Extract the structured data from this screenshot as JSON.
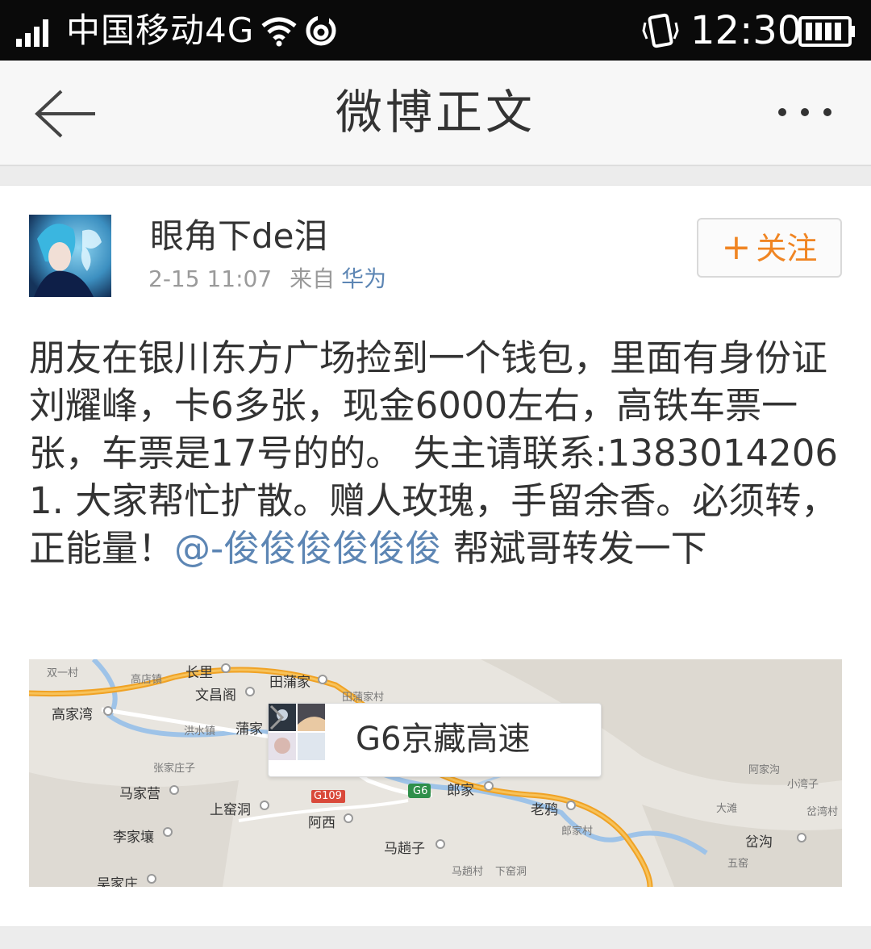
{
  "status_bar": {
    "carrier": "中国移动4G",
    "time": "12:30",
    "icons": [
      "signal-icon",
      "wifi-icon",
      "sync-icon",
      "vibrate-icon",
      "battery-icon"
    ]
  },
  "header": {
    "title": "微博正文",
    "back_icon": "back-arrow-icon",
    "more_icon": "more-dots-icon"
  },
  "post": {
    "username": "眼角下de泪",
    "timestamp": "2-15 11:07",
    "source_label": "来自",
    "source": "华为",
    "follow_plus": "+",
    "follow_label": "关注",
    "text_main": "朋友在银川东方广场捡到一个钱包，里面有身份证刘耀峰，卡6多张，现金6000左右，高铁车票一张，车票是17号的的。 失主请联系:13830142061. 大家帮忙扩散。赠人玫瑰，手留余香。必须转，正能量！",
    "mention": "@-俊俊俊俊俊俊",
    "text_after": " 帮斌哥转发一下"
  },
  "location": {
    "name": "G6京藏高速",
    "chevron_icon": "chevron-right-icon",
    "map_labels": {
      "shuangyicun": "双一村",
      "gaodianzhen": "高店镇",
      "changli": "长里",
      "wenchangge": "文昌阁",
      "tianpujia": "田蒲家",
      "tianpujiacun": "田蒲家村",
      "gaojiawan": "高家湾",
      "hongshuizhen": "洪水镇",
      "pujia": "蒲家",
      "zhangjiazhuangzi": "张家庄子",
      "majiaying": "马家营",
      "shangyaodong": "上窑洞",
      "g109": "G109",
      "g6": "G6",
      "langjia": "郎家",
      "laoya": "老鸦",
      "axi": "阿西",
      "lijiarang": "李家壤",
      "mazhaozi": "马趟子",
      "langjiacun": "郎家村",
      "mazhaocun": "马趟村",
      "xiayao": "下窑洞",
      "wujiazhuang": "吴家庄",
      "ajiagou": "阿家沟",
      "xiaowanzi": "小湾子",
      "dawan": "大滩",
      "chawancun": "岔湾村",
      "chagou": "岔沟",
      "wuyao": "五窑"
    }
  }
}
